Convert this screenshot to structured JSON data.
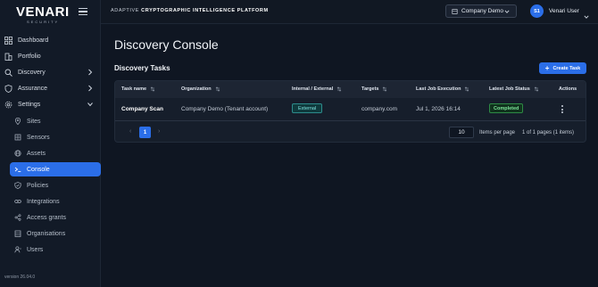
{
  "brand": {
    "logo_word": "VENARI",
    "logo_sub": "SECURITY"
  },
  "header": {
    "platform_prefix": "ADAPTIVE",
    "platform_rest": "CRYPTOGRAPHIC INTELLIGENCE PLATFORM",
    "tenant": "Company Demo",
    "user_initials": "S1",
    "user_name": "Venari User"
  },
  "sidebar": {
    "items": [
      {
        "label": "Dashboard",
        "icon": "dashboard-icon"
      },
      {
        "label": "Portfolio",
        "icon": "building-icon"
      },
      {
        "label": "Discovery",
        "icon": "search-icon"
      },
      {
        "label": "Assurance",
        "icon": "shield-icon"
      },
      {
        "label": "Settings",
        "icon": "gear-icon"
      }
    ],
    "sub_items": [
      {
        "label": "Sites",
        "icon": "map-pin-icon"
      },
      {
        "label": "Sensors",
        "icon": "sensor-icon"
      },
      {
        "label": "Assets",
        "icon": "globe-icon"
      },
      {
        "label": "Console",
        "icon": "terminal-icon"
      },
      {
        "label": "Policies",
        "icon": "policy-shield-icon"
      },
      {
        "label": "Integrations",
        "icon": "link-icon"
      },
      {
        "label": "Access grants",
        "icon": "share-icon"
      },
      {
        "label": "Organisations",
        "icon": "organisation-icon"
      },
      {
        "label": "Users",
        "icon": "user-icon"
      }
    ],
    "active_sub": "Console",
    "version": "version 26.04.0"
  },
  "main": {
    "page_title": "Discovery Console",
    "section_title": "Discovery Tasks",
    "create_label": "Create Task"
  },
  "table": {
    "columns": [
      "Task name",
      "Organization",
      "Internal / External",
      "Targets",
      "Last Job Execution",
      "Latest Job Status",
      "Actions"
    ],
    "rows": [
      {
        "task_name": "Company Scan",
        "organization": "Company Demo (Tenant account)",
        "scope": "External",
        "targets": "company.com",
        "last_execution": "Jul 1, 2026 16:14",
        "status": "Completed"
      }
    ]
  },
  "pagination": {
    "current_page": "1",
    "items_per_page": "10",
    "items_per_page_label": "Items per page",
    "page_info": "1 of 1 pages (1 items)"
  },
  "colors": {
    "accent": "#2b6ee8",
    "background": "#0f1622",
    "external_badge": "#2d8c8c",
    "completed_badge": "#2e8a45"
  }
}
